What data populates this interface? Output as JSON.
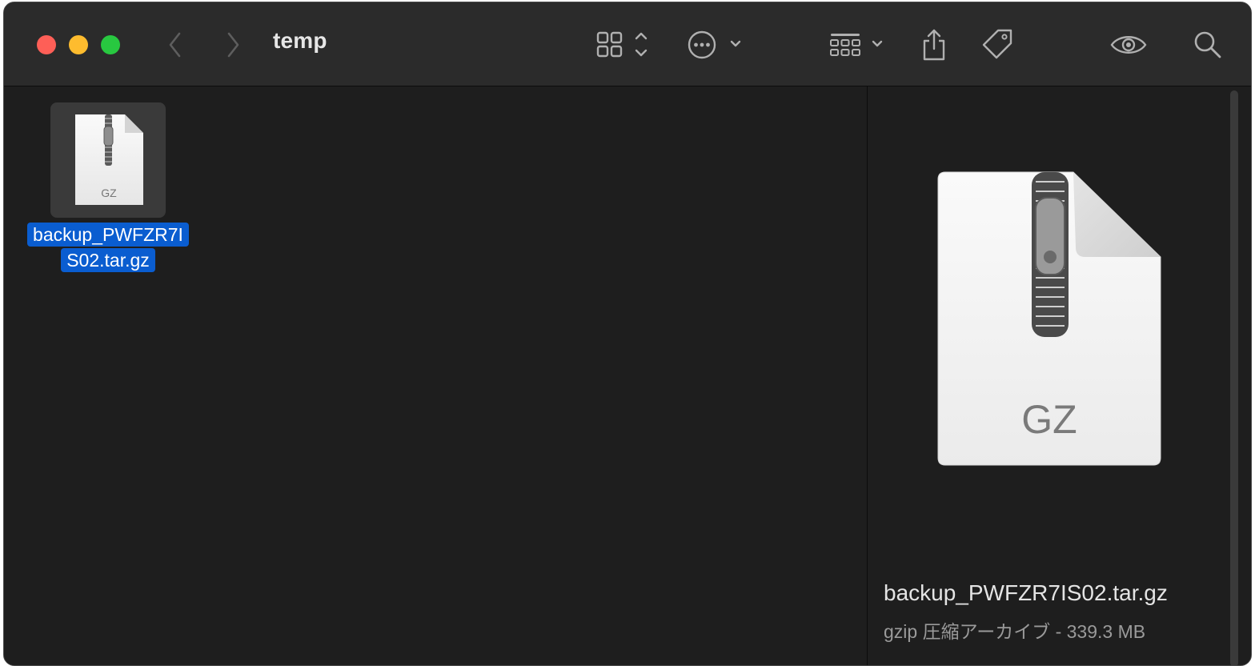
{
  "window": {
    "title": "temp"
  },
  "toolbar": {
    "back": "chevron-left-icon",
    "forward": "chevron-right-icon",
    "view": "grid-view-icon",
    "action": "more-icon",
    "group": "group-icon",
    "share": "share-icon",
    "tag": "tag-icon",
    "preview": "eye-icon",
    "search": "search-icon"
  },
  "files": [
    {
      "icon_label": "GZ",
      "name_line1": "backup_PWFZR7I",
      "name_line2": "S02.tar.gz",
      "selected": true
    }
  ],
  "preview": {
    "icon_label": "GZ",
    "name": "backup_PWFZR7IS02.tar.gz",
    "kind_size": "gzip 圧縮アーカイブ - 339.3 MB"
  },
  "colors": {
    "selection": "#0a5dd0",
    "close": "#fe5f57",
    "minimize": "#febc2e",
    "maximize": "#28c840"
  }
}
